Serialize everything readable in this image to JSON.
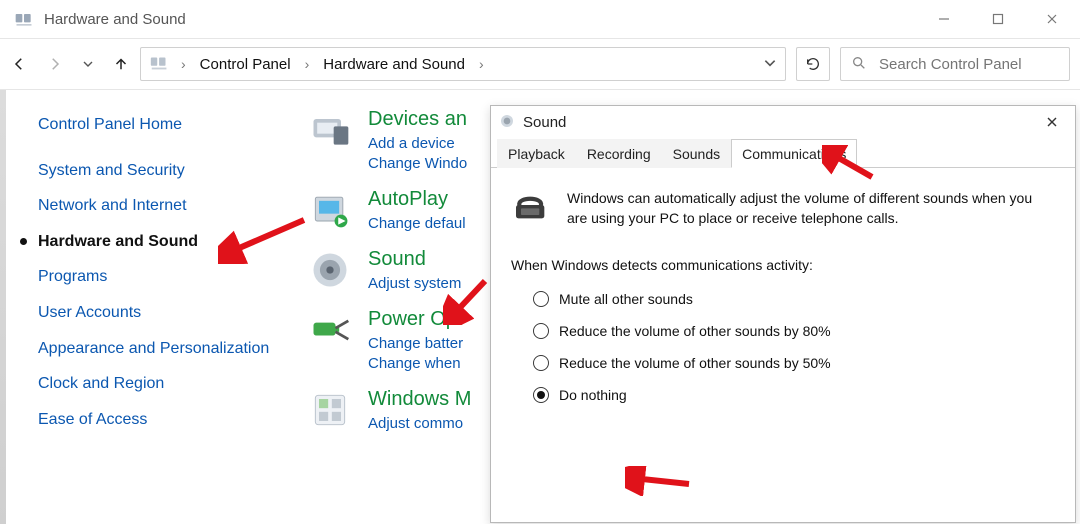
{
  "window": {
    "title": "Hardware and Sound"
  },
  "address": {
    "seg1": "Control Panel",
    "seg2": "Hardware and Sound"
  },
  "search": {
    "placeholder": "Search Control Panel"
  },
  "sidebar": {
    "items": [
      {
        "label": "Control Panel Home"
      },
      {
        "label": "System and Security"
      },
      {
        "label": "Network and Internet"
      },
      {
        "label": "Hardware and Sound"
      },
      {
        "label": "Programs"
      },
      {
        "label": "User Accounts"
      },
      {
        "label": "Appearance and Personalization"
      },
      {
        "label": "Clock and Region"
      },
      {
        "label": "Ease of Access"
      }
    ],
    "active_index": 3
  },
  "categories": [
    {
      "title": "Devices an",
      "links": [
        "Add a device",
        "Change Windo"
      ]
    },
    {
      "title": "AutoPlay",
      "links": [
        "Change defaul"
      ]
    },
    {
      "title": "Sound",
      "links": [
        "Adjust system"
      ]
    },
    {
      "title": "Power Opt",
      "links": [
        "Change batter",
        "Change when"
      ]
    },
    {
      "title": "Windows M",
      "links": [
        "Adjust commo"
      ]
    }
  ],
  "dialog": {
    "title": "Sound",
    "tabs": [
      "Playback",
      "Recording",
      "Sounds",
      "Communications"
    ],
    "active_tab": 3,
    "intro": "Windows can automatically adjust the volume of different sounds when you are using your PC to place or receive telephone calls.",
    "prompt": "When Windows detects communications activity:",
    "options": [
      "Mute all other sounds",
      "Reduce the volume of other sounds by 80%",
      "Reduce the volume of other sounds by 50%",
      "Do nothing"
    ],
    "selected": 3
  }
}
